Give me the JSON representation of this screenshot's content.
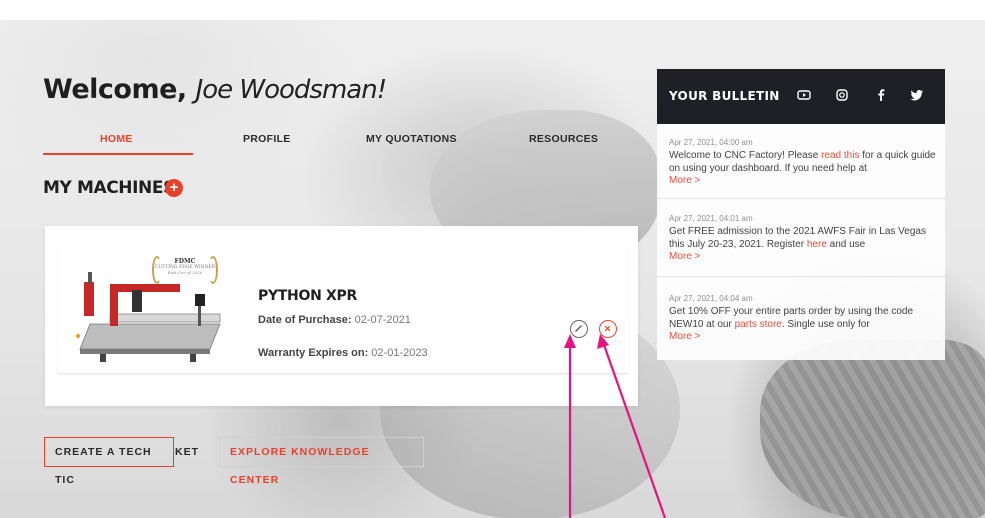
{
  "welcome": {
    "greeting": "Welcome,",
    "name": "Joe Woodsman!"
  },
  "nav": {
    "items": [
      {
        "label": "HOME",
        "active": true
      },
      {
        "label": "PROFILE",
        "active": false
      },
      {
        "label": "MY QUOTATIONS",
        "active": false
      },
      {
        "label": "RESOURCES",
        "active": false
      }
    ]
  },
  "machines": {
    "title": "MY MACHINES",
    "add_icon": "plus-icon",
    "items": [
      {
        "name": "PYTHON XPR",
        "purchase_label": "Date of Purchase:",
        "purchase_date": "02-07-2021",
        "warranty_label": "Warranty Expires on:",
        "warranty_date": "02-01-2023",
        "award": {
          "title": "FDMC",
          "subtitle": "CUTTING EDGE WINNER",
          "caption": "Best Cnc of 2020"
        },
        "edit_icon": "pencil-icon",
        "delete_icon": "close-icon"
      }
    ]
  },
  "actions": {
    "tech_ticket": "CREATE A TECH TIC",
    "tech_ticket_overflow": "KET",
    "knowledge_center": "EXPLORE KNOWLEDGE CENTER"
  },
  "bulletin": {
    "title": "YOUR BULLETIN",
    "social_icons": [
      "youtube-icon",
      "instagram-icon",
      "facebook-icon",
      "twitter-icon"
    ],
    "items": [
      {
        "date": "Apr 27, 2021, 04:00 am",
        "text_before": "Welcome to CNC Factory! Please ",
        "link": "read this",
        "text_after": " for a quick guide on using your dashboard. If you need help at",
        "more": "More >"
      },
      {
        "date": "Apr 27, 2021, 04:01 am",
        "text_before": "Get FREE admission to the 2021 AWFS Fair in Las Vegas this July 20-23, 2021. Register ",
        "link": "here",
        "text_after": " and use",
        "more": "More >"
      },
      {
        "date": "Apr 27, 2021, 04:04 am",
        "text_before": "Get 10% OFF your entire parts order by using the code NEW10 at our ",
        "link": "parts store",
        "text_after": ". Single use only for",
        "more": "More >"
      }
    ]
  },
  "colors": {
    "accent": "#e8412c",
    "dark": "#1f1f26",
    "annotation_arrow": "#e6137f"
  }
}
